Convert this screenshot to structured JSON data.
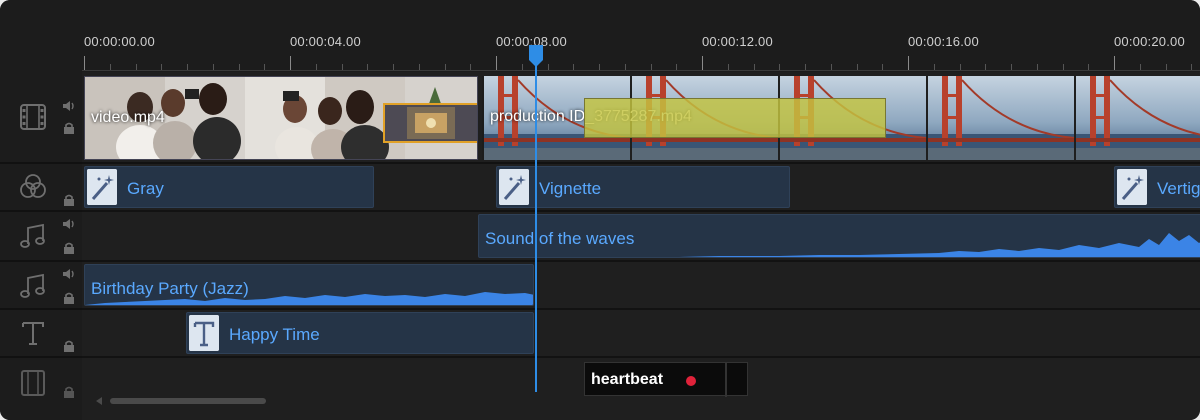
{
  "ruler": {
    "labels": [
      "00:00:00.00",
      "00:00:04.00",
      "00:00:08.00",
      "00:00:12.00",
      "00:00:16.00",
      "00:00:20.00"
    ]
  },
  "video_track": {
    "clip1_label": "video.mp4",
    "clip2_label": "production ID_3775287.mp4"
  },
  "effect_track": {
    "clips": [
      "Gray",
      "Vignette",
      "Vertig"
    ]
  },
  "audio_track_1": {
    "clip_label": "Sound of the waves"
  },
  "audio_track_2": {
    "clip_label": "Birthday Party (Jazz)"
  },
  "text_track": {
    "clip_label": "Happy Time"
  },
  "overlay_track": {
    "clip_label": "heartbeat"
  },
  "colors": {
    "accent": "#2e8de6",
    "clip_bg": "#253447",
    "clip_text": "#5aa9ff",
    "pip_border": "#e1a127"
  }
}
